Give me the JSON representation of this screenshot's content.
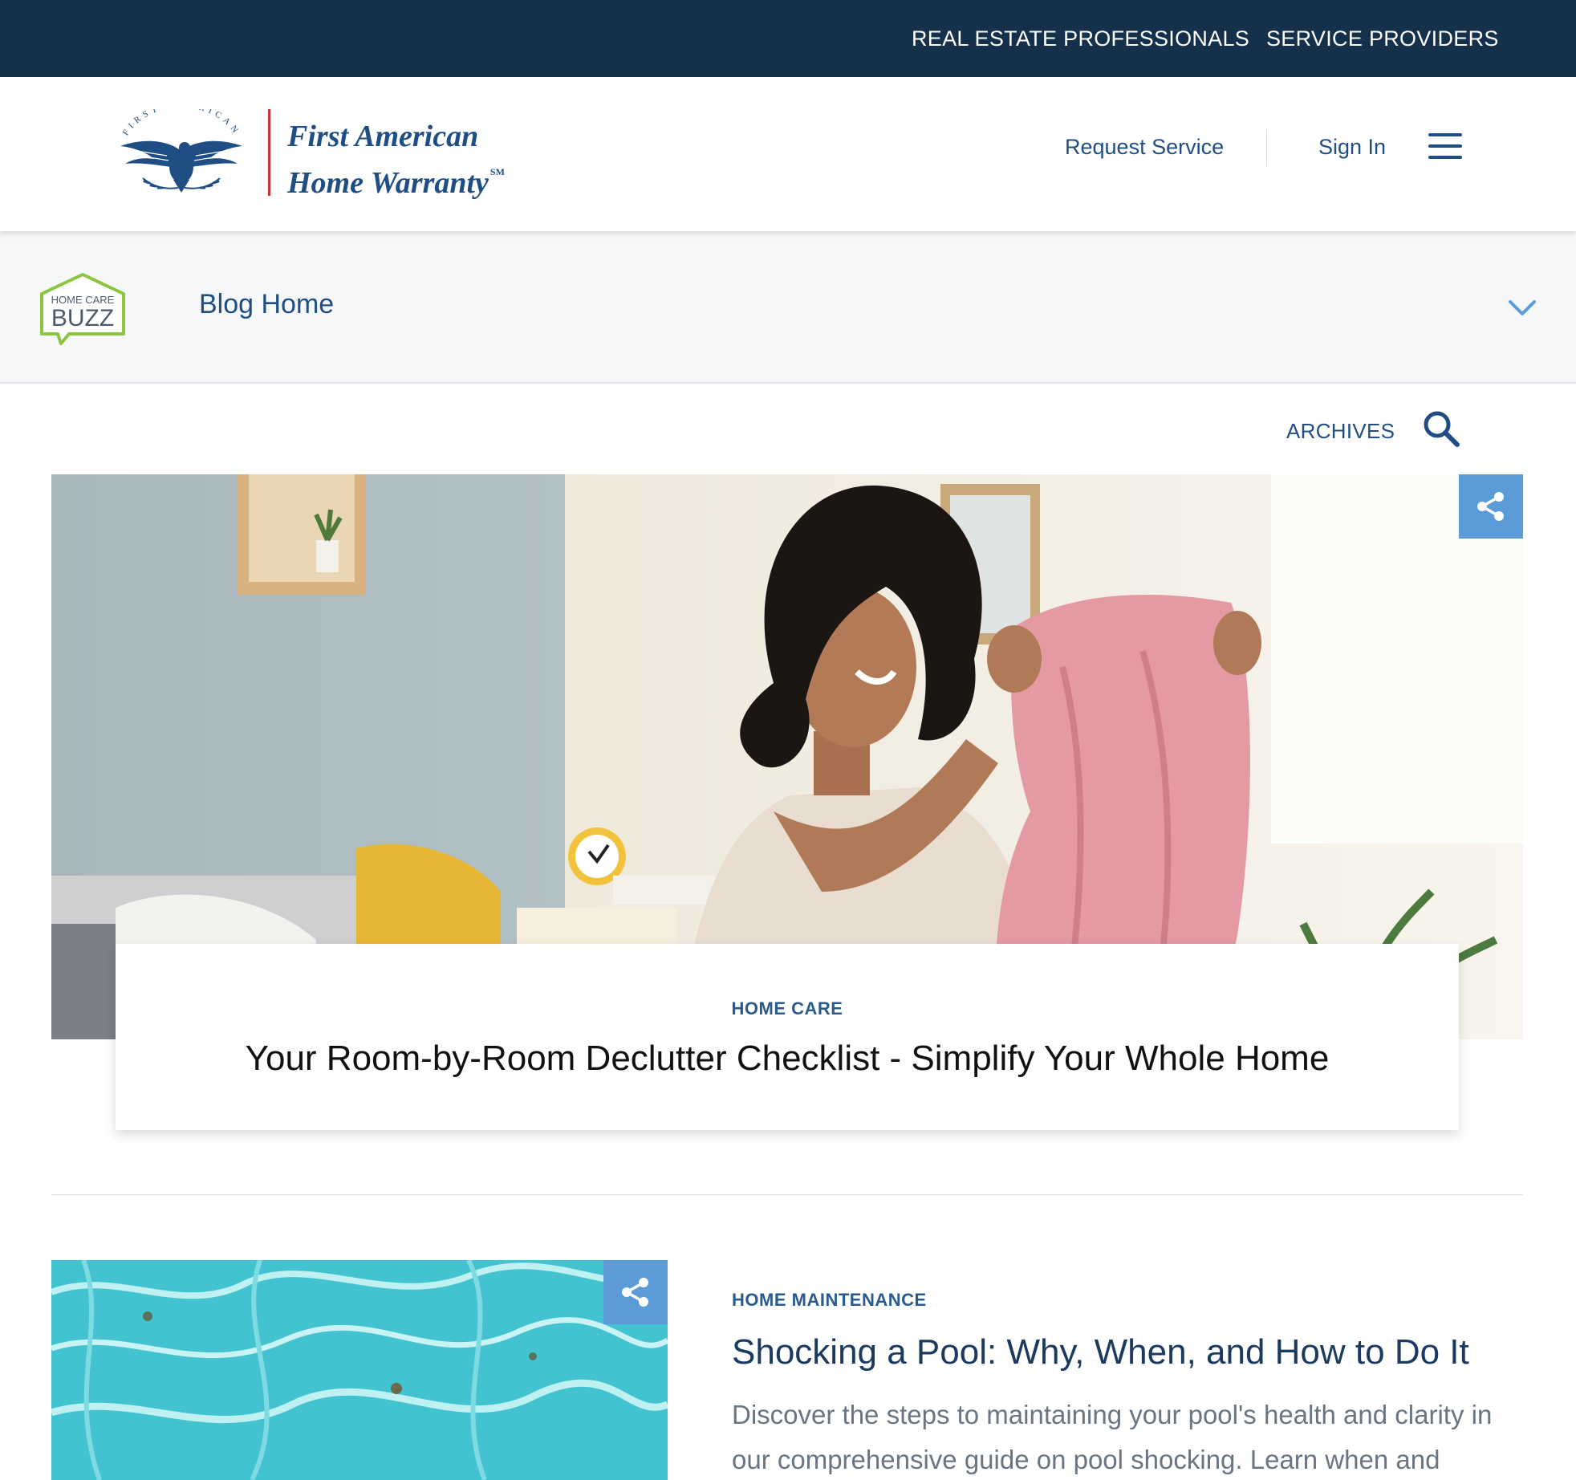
{
  "topbar": {
    "real_estate": "REAL ESTATE PROFESSIONALS",
    "service_providers": "SERVICE PROVIDERS"
  },
  "header": {
    "seal_text": "FIRST AMERICAN",
    "logo_line1": "First American",
    "logo_line2": "Home Warranty",
    "logo_mark": "SM",
    "request_service": "Request Service",
    "sign_in": "Sign In",
    "menu_icon": "hamburger-icon"
  },
  "blogbar": {
    "badge_small": "HOME CARE",
    "badge_big": "BUZZ",
    "blog_home": "Blog Home",
    "dropdown_icon": "chevron-down-icon"
  },
  "tools": {
    "archives": "ARCHIVES",
    "search_icon": "search-icon"
  },
  "featured": {
    "category": "HOME CARE",
    "title": "Your Room-by-Room Declutter Checklist - Simplify Your Whole Home",
    "share_icon": "share-icon"
  },
  "articles": [
    {
      "category": "HOME MAINTENANCE",
      "title": "Shocking a Pool: Why, When, and How to Do It",
      "description": "Discover the steps to maintaining your pool's health and clarity in our comprehensive guide on pool shocking. Learn when and",
      "share_icon": "share-icon"
    }
  ],
  "colors": {
    "topbar": "#14304b",
    "brand_blue": "#1f4e85",
    "share_blue": "#5b9bd8",
    "logo_red": "#c8323a",
    "buzz_green": "#8cc63f"
  }
}
